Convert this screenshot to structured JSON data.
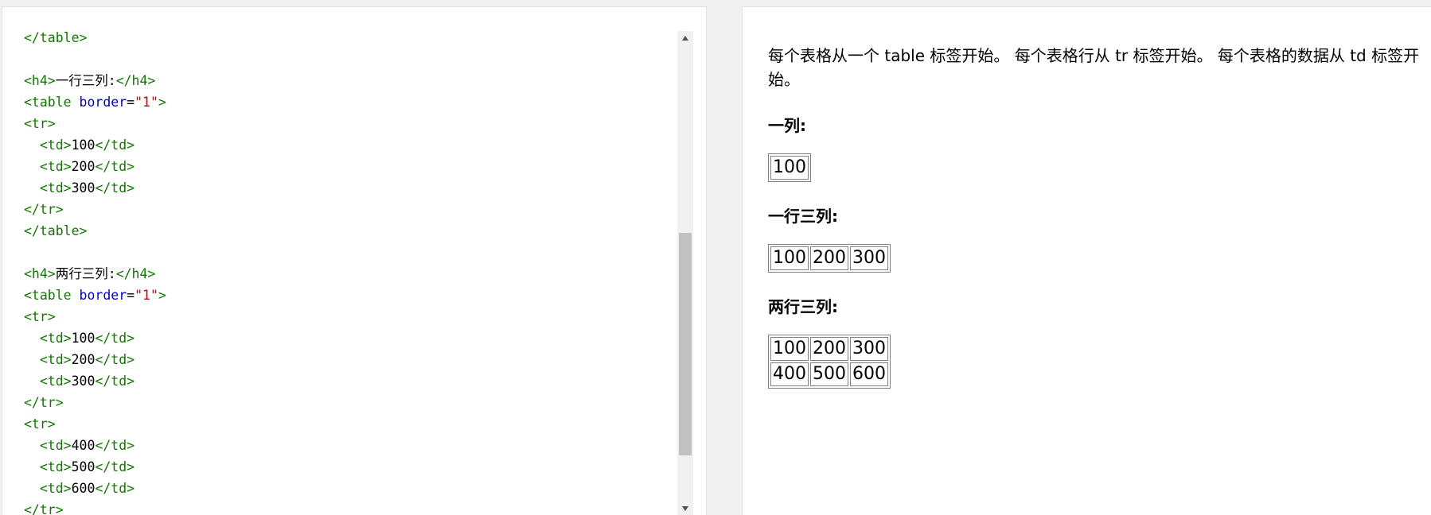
{
  "editor": {
    "lines": [
      [
        {
          "c": "tag",
          "t": "</table>"
        }
      ],
      [],
      [
        {
          "c": "tag",
          "t": "<h4>"
        },
        {
          "c": "txt",
          "t": "一行三列:"
        },
        {
          "c": "tag",
          "t": "</h4>"
        }
      ],
      [
        {
          "c": "tag",
          "t": "<table "
        },
        {
          "c": "attr",
          "t": "border"
        },
        {
          "c": "txt",
          "t": "="
        },
        {
          "c": "val",
          "t": "\"1\""
        },
        {
          "c": "tag",
          "t": ">"
        }
      ],
      [
        {
          "c": "tag",
          "t": "<tr>"
        }
      ],
      [
        {
          "c": "txt",
          "t": "  "
        },
        {
          "c": "tag",
          "t": "<td>"
        },
        {
          "c": "txt",
          "t": "100"
        },
        {
          "c": "tag",
          "t": "</td>"
        }
      ],
      [
        {
          "c": "txt",
          "t": "  "
        },
        {
          "c": "tag",
          "t": "<td>"
        },
        {
          "c": "txt",
          "t": "200"
        },
        {
          "c": "tag",
          "t": "</td>"
        }
      ],
      [
        {
          "c": "txt",
          "t": "  "
        },
        {
          "c": "tag",
          "t": "<td>"
        },
        {
          "c": "txt",
          "t": "300"
        },
        {
          "c": "tag",
          "t": "</td>"
        }
      ],
      [
        {
          "c": "tag",
          "t": "</tr>"
        }
      ],
      [
        {
          "c": "tag",
          "t": "</table>"
        }
      ],
      [],
      [
        {
          "c": "tag",
          "t": "<h4>"
        },
        {
          "c": "txt",
          "t": "两行三列:"
        },
        {
          "c": "tag",
          "t": "</h4>"
        }
      ],
      [
        {
          "c": "tag",
          "t": "<table "
        },
        {
          "c": "attr",
          "t": "border"
        },
        {
          "c": "txt",
          "t": "="
        },
        {
          "c": "val",
          "t": "\"1\""
        },
        {
          "c": "tag",
          "t": ">"
        }
      ],
      [
        {
          "c": "tag",
          "t": "<tr>"
        }
      ],
      [
        {
          "c": "txt",
          "t": "  "
        },
        {
          "c": "tag",
          "t": "<td>"
        },
        {
          "c": "txt",
          "t": "100"
        },
        {
          "c": "tag",
          "t": "</td>"
        }
      ],
      [
        {
          "c": "txt",
          "t": "  "
        },
        {
          "c": "tag",
          "t": "<td>"
        },
        {
          "c": "txt",
          "t": "200"
        },
        {
          "c": "tag",
          "t": "</td>"
        }
      ],
      [
        {
          "c": "txt",
          "t": "  "
        },
        {
          "c": "tag",
          "t": "<td>"
        },
        {
          "c": "txt",
          "t": "300"
        },
        {
          "c": "tag",
          "t": "</td>"
        }
      ],
      [
        {
          "c": "tag",
          "t": "</tr>"
        }
      ],
      [
        {
          "c": "tag",
          "t": "<tr>"
        }
      ],
      [
        {
          "c": "txt",
          "t": "  "
        },
        {
          "c": "tag",
          "t": "<td>"
        },
        {
          "c": "txt",
          "t": "400"
        },
        {
          "c": "tag",
          "t": "</td>"
        }
      ],
      [
        {
          "c": "txt",
          "t": "  "
        },
        {
          "c": "tag",
          "t": "<td>"
        },
        {
          "c": "txt",
          "t": "500"
        },
        {
          "c": "tag",
          "t": "</td>"
        }
      ],
      [
        {
          "c": "txt",
          "t": "  "
        },
        {
          "c": "tag",
          "t": "<td>"
        },
        {
          "c": "txt",
          "t": "600"
        },
        {
          "c": "tag",
          "t": "</td>"
        }
      ],
      [
        {
          "c": "tag",
          "t": "</tr>"
        }
      ]
    ],
    "colors": {
      "tag": "#117700",
      "attr": "#0000cc",
      "value": "#aa1111",
      "text": "#000000"
    }
  },
  "preview": {
    "intro": "每个表格从一个 table 标签开始。 每个表格行从 tr 标签开始。 每个表格的数据从 td 标签开始。",
    "sections": [
      {
        "heading": "一列:",
        "rows": [
          [
            "100"
          ]
        ]
      },
      {
        "heading": "一行三列:",
        "rows": [
          [
            "100",
            "200",
            "300"
          ]
        ]
      },
      {
        "heading": "两行三列:",
        "rows": [
          [
            "100",
            "200",
            "300"
          ],
          [
            "400",
            "500",
            "600"
          ]
        ]
      }
    ]
  }
}
